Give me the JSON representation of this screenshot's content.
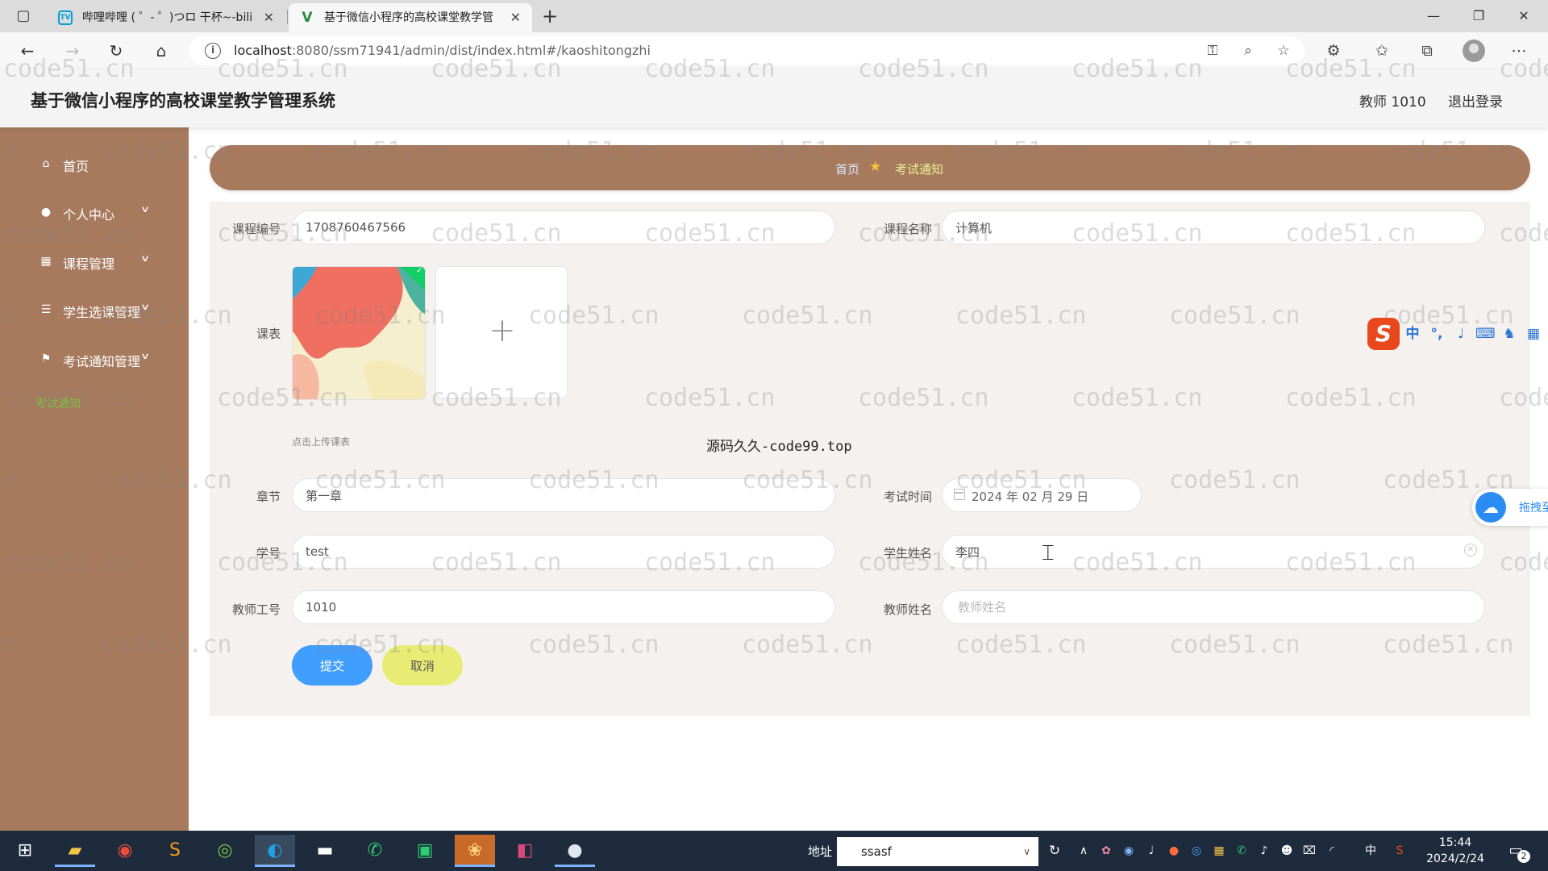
{
  "browser": {
    "tabs": [
      {
        "title": "哔哩哔哩 ( ゜- ゜)つロ 干杯~-bilibili",
        "favicon": "bilibili-icon",
        "active": false
      },
      {
        "title": "基于微信小程序的高校课堂教学管理系统",
        "favicon": "vue-icon",
        "active": true
      }
    ],
    "url_host": "localhost",
    "url_rest": ":8080/ssm71941/admin/dist/index.html#/kaoshitongzhi"
  },
  "header": {
    "title": "基于微信小程序的高校课堂教学管理系统",
    "user": "教师 1010",
    "logout": "退出登录"
  },
  "sidebar": {
    "items": [
      {
        "label": "首页",
        "icon": "home-icon"
      },
      {
        "label": "个人中心",
        "icon": "user-icon"
      },
      {
        "label": "课程管理",
        "icon": "grid-icon"
      },
      {
        "label": "学生选课管理",
        "icon": "list-icon"
      },
      {
        "label": "考试通知管理",
        "icon": "flag-icon"
      }
    ],
    "sub_item": "考试通知"
  },
  "breadcrumb": {
    "home": "首页",
    "current": "考试通知"
  },
  "form": {
    "course_no_label": "课程编号",
    "course_no": "1708760467566",
    "course_name_label": "课程名称",
    "course_name": "计算机",
    "schedule_label": "课表",
    "upload_tip": "点击上传课表",
    "chapter_label": "章节",
    "chapter": "第一章",
    "exam_time_label": "考试时间",
    "exam_time": "2024 年 02 月 29 日",
    "student_no_label": "学号",
    "student_no": "test",
    "student_name_label": "学生姓名",
    "student_name": "李四",
    "teacher_no_label": "教师工号",
    "teacher_no": "1010",
    "teacher_name_label": "教师姓名",
    "teacher_name": "",
    "teacher_name_placeholder": "教师姓名",
    "submit": "提交",
    "cancel": "取消"
  },
  "overlays": {
    "watermark": "code51.cn",
    "center_watermark": "源码久久-code99.top",
    "ime_cn": "中",
    "drag_label": "拖拽至"
  },
  "taskbar": {
    "addr_label": "地址",
    "addr_value": "ssasf",
    "ime_indicator": "中",
    "time": "15:44",
    "date": "2024/2/24",
    "notifications": "2"
  },
  "colors": {
    "sidebar": "#a77a5e",
    "accent_green": "#7ac142",
    "submit": "#409eff",
    "cancel": "#e8ec74",
    "taskbar": "#1d2b3c"
  }
}
